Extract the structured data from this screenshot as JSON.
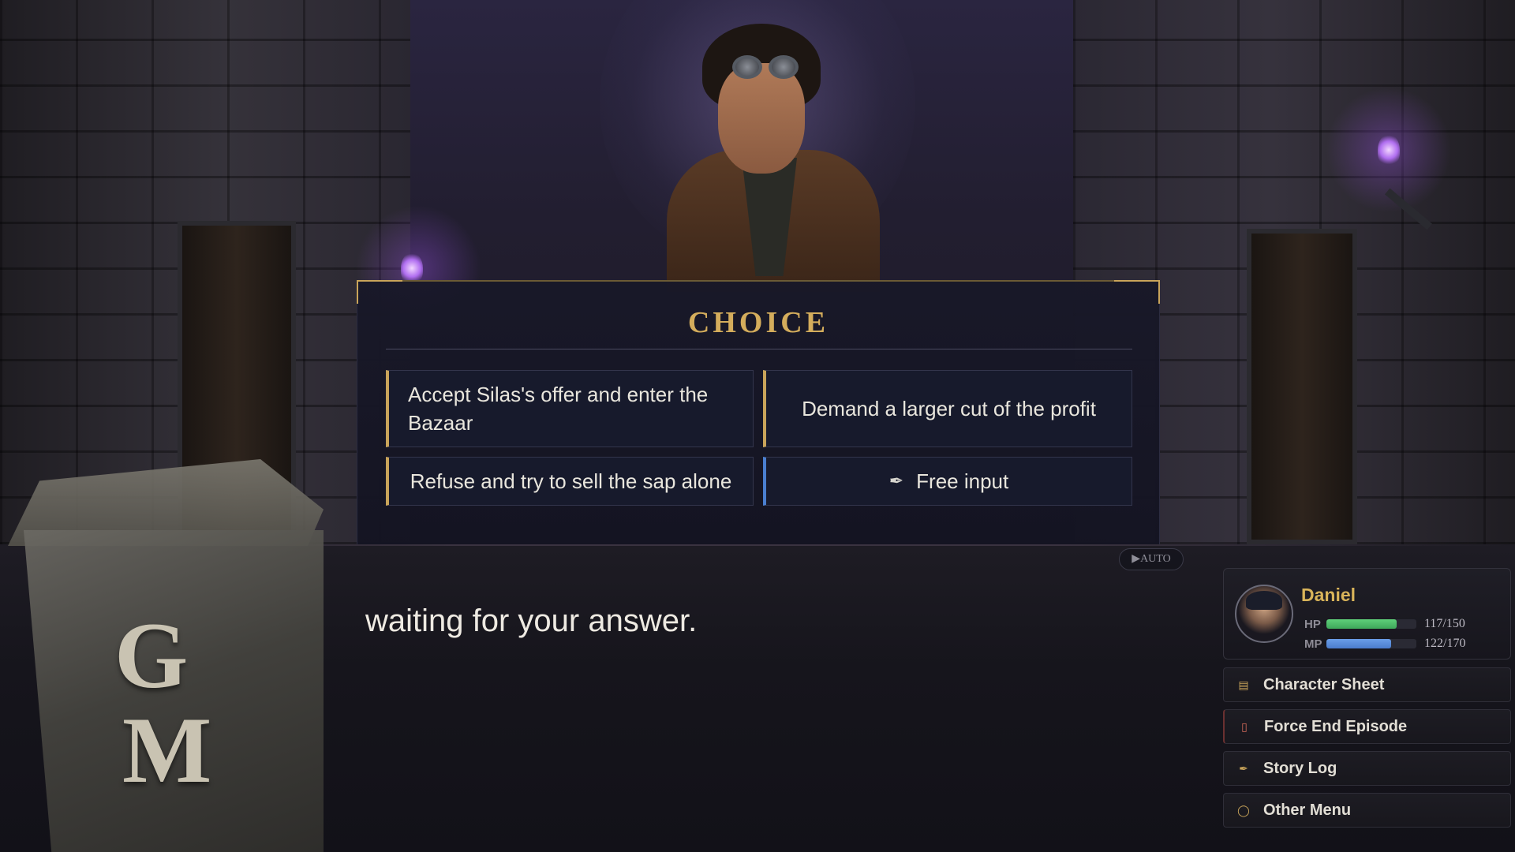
{
  "choice": {
    "title": "CHOICE",
    "options": [
      {
        "label": "Accept Silas's offer and enter the Bazaar"
      },
      {
        "label": "Demand a larger cut of the profit"
      },
      {
        "label": "Refuse and try to sell the sap alone"
      },
      {
        "label": "Free input",
        "icon": "quill-icon"
      }
    ]
  },
  "dialogue": {
    "text": "waiting for your answer.",
    "auto_label": "▶AUTO"
  },
  "gm": {
    "letter_top": "G",
    "letter_bottom": "M"
  },
  "character": {
    "name": "Daniel",
    "hp": {
      "label": "HP",
      "current": 117,
      "max": 150,
      "text": "117/150",
      "fill_fraction": 0.78
    },
    "mp": {
      "label": "MP",
      "current": 122,
      "max": 170,
      "text": "122/170",
      "fill_fraction": 0.72
    }
  },
  "menu": {
    "items": [
      {
        "label": "Character Sheet",
        "icon": "character-sheet-icon"
      },
      {
        "label": "Force End Episode",
        "icon": "force-end-icon"
      },
      {
        "label": "Story Log",
        "icon": "quill-icon"
      },
      {
        "label": "Other Menu",
        "icon": "shield-icon"
      }
    ]
  },
  "colors": {
    "accent_gold": "#c9a45a",
    "free_input_accent": "#4a7fd0",
    "hp": "#4cc06a",
    "mp": "#5a8ede"
  }
}
